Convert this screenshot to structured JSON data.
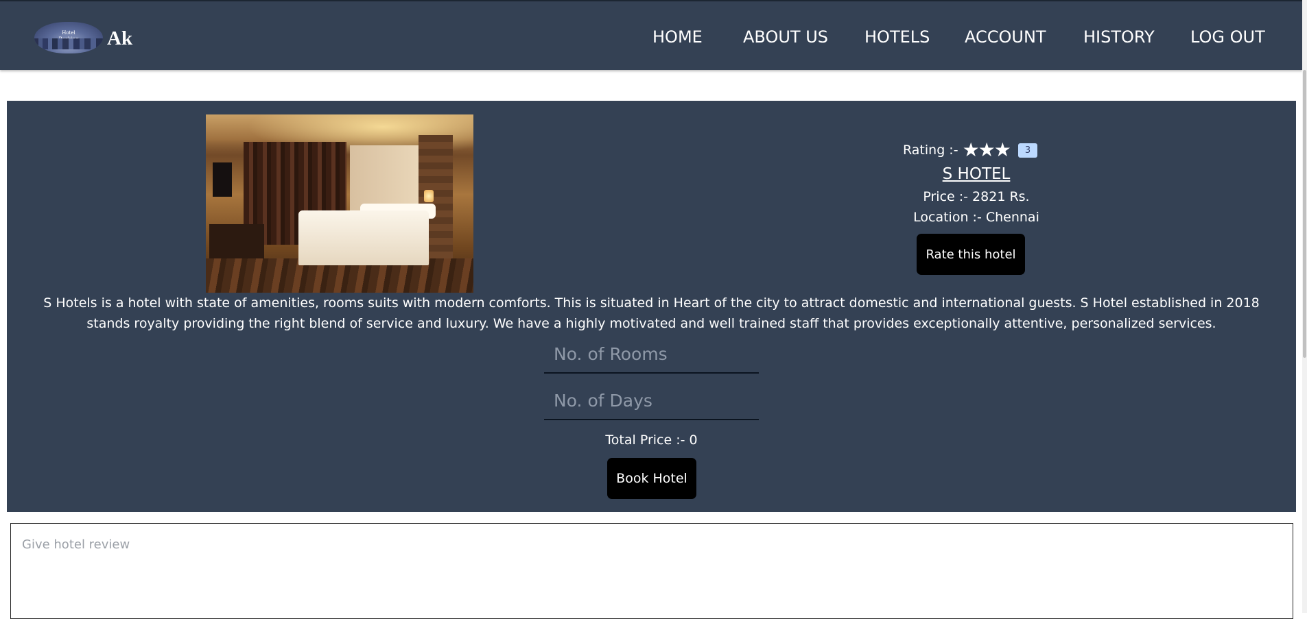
{
  "brand": {
    "logo_text": "Ak",
    "logo_image_text_1": "Hotel",
    "logo_image_text_2": "Booking"
  },
  "nav": {
    "items": [
      {
        "label": "HOME"
      },
      {
        "label": "ABOUT US"
      },
      {
        "label": "HOTELS"
      },
      {
        "label": "ACCOUNT"
      },
      {
        "label": "HISTORY"
      },
      {
        "label": "LOG OUT"
      }
    ]
  },
  "hotel": {
    "rating_label": "Rating :-",
    "rating_stars": 3,
    "rating_badge": "3",
    "name": "S HOTEL",
    "price": "Price :- 2821 Rs.",
    "location": "Location :- Chennai",
    "rate_button": "Rate this hotel",
    "description": "S Hotels is a hotel with state of amenities, rooms suits with modern comforts. This is situated in Heart of the city to attract domestic and international guests. S Hotel established in 2018 stands royalty providing the right blend of service and luxury. We have a highly motivated and well trained staff that provides exceptionally attentive, personalized services.",
    "image_icon": "hotel-room-photo"
  },
  "booking": {
    "rooms_placeholder": "No. of Rooms",
    "days_placeholder": "No. of Days",
    "total_price": "Total Price :- 0",
    "book_button": "Book Hotel"
  },
  "review": {
    "placeholder": "Give hotel review"
  },
  "colors": {
    "navbar": "#344154",
    "panel": "#344154",
    "button": "#000000",
    "badge": "#bcd9ff"
  }
}
